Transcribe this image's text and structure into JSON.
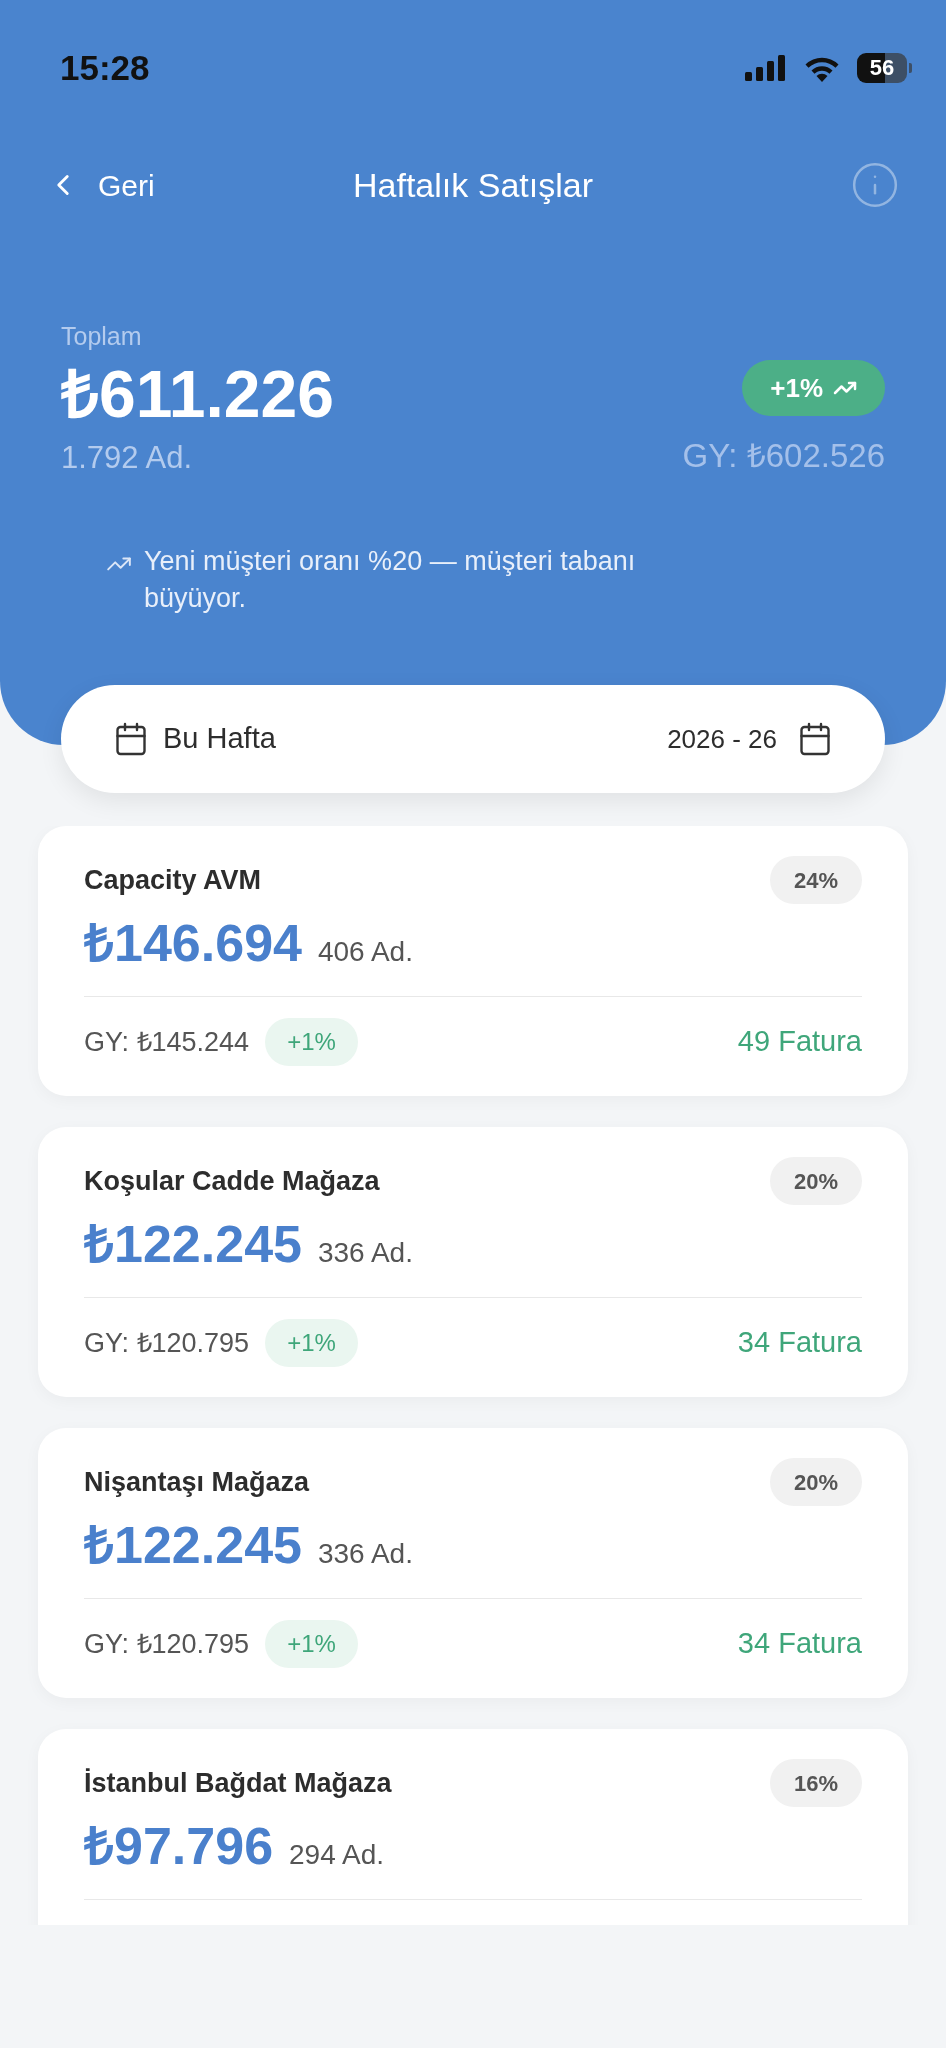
{
  "status_bar": {
    "time": "15:28",
    "battery": "56"
  },
  "nav": {
    "back_label": "Geri",
    "title": "Haftalık Satışlar"
  },
  "summary": {
    "label": "Toplam",
    "total": "₺611.226",
    "quantity": "1.792 Ad.",
    "change": "+1%",
    "rising": true,
    "previous": "GY: ₺602.526"
  },
  "insight": {
    "text": "Yeni müşteri oranı %20 — müşteri tabanı büyüyor."
  },
  "period": {
    "label": "Bu Hafta",
    "week": "2026 - 26"
  },
  "stores": [
    {
      "name": "Capacity AVM",
      "share": "24%",
      "amount": "₺146.694",
      "quantity": "406 Ad.",
      "previous": "GY: ₺145.244",
      "change": "+1%",
      "invoices": "49 Fatura"
    },
    {
      "name": "Koşular Cadde Mağaza",
      "share": "20%",
      "amount": "₺122.245",
      "quantity": "336 Ad.",
      "previous": "GY: ₺120.795",
      "change": "+1%",
      "invoices": "34 Fatura"
    },
    {
      "name": "Nişantaşı Mağaza",
      "share": "20%",
      "amount": "₺122.245",
      "quantity": "336 Ad.",
      "previous": "GY: ₺120.795",
      "change": "+1%",
      "invoices": "34 Fatura"
    },
    {
      "name": "İstanbul Bağdat Mağaza",
      "share": "16%",
      "amount": "₺97.796",
      "quantity": "294 Ad."
    }
  ]
}
